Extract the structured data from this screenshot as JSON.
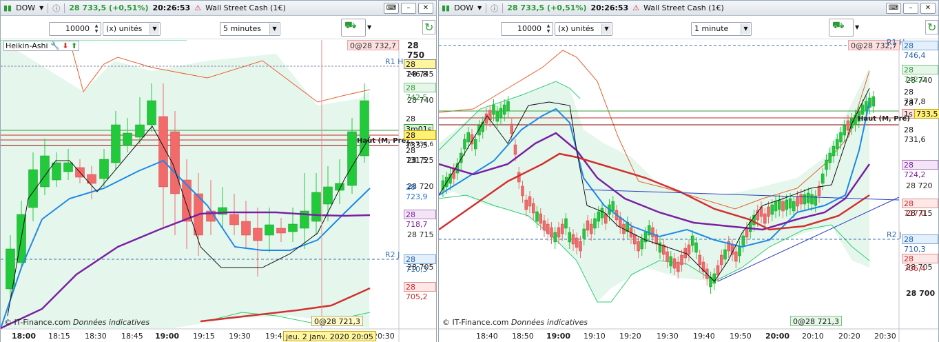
{
  "left": {
    "title": {
      "symbol": "DOW",
      "price": "28 733,5 (+0,51%)",
      "time": "20:26:53",
      "name": "Wall Street Cash (1€)"
    },
    "toolbar": {
      "qty": "10000",
      "unit": "(x) unités",
      "period": "5 minutes"
    },
    "indicator": "Heikin-Ashi",
    "order_flag": "0@28 732,7",
    "order_flag_bottom": "0@28 721,3",
    "y_ticks": [
      "28 750",
      "28 745",
      "28 740",
      "28 735",
      "28 730",
      "28 725",
      "28 720",
      "28 715",
      "28 710",
      "28 705"
    ],
    "price_tags": {
      "r1h_label": "R1 H",
      "r1h": "28 746,8",
      "bb_up": "28 742,5",
      "p735": "28 735,0",
      "countdown": "3m01s",
      "last": "28 733,5",
      "p734": "28 734,6",
      "p731": "28 731,5",
      "ma_blue": "28 723,9",
      "ma_purple": "28 718,7",
      "r2j_label": "R2 J",
      "r2j": "28 710,3",
      "ma_red": "28 705,2"
    },
    "haut_label": "Haut (M, Pré)",
    "x_labels": [
      "18:00",
      "18:15",
      "18:30",
      "18:45",
      "19:00",
      "19:15",
      "19:30",
      "19:45",
      "20:30"
    ],
    "crosshair_date": "jeu. 2 janv. 2020 20:05",
    "footer": {
      "brand": "© IT-Finance.com",
      "note": "Données indicatives"
    }
  },
  "right": {
    "title": {
      "symbol": "DOW",
      "price": "28 733,5 (+0,51%)",
      "time": "20:26:53",
      "name": "Wall Street Cash (1€)"
    },
    "toolbar": {
      "qty": "10000",
      "unit": "(x) unités",
      "period": "1 minute"
    },
    "order_flag": "0@28 732,7",
    "order_flag_bottom": "0@28 721,3",
    "y_ticks": [
      "28 740",
      "28 735",
      "28 730",
      "28 725",
      "28 720",
      "28 715",
      "28 710",
      "28 705",
      "28 700"
    ],
    "price_tags": {
      "r1_label": "R1 H",
      "r1": "28 746,4",
      "bb_up": "28 742,0",
      "p737": "28 737,8",
      "p734": "28 734,4",
      "countdown": "1s",
      "last": "733,5",
      "p731": "28 731,6",
      "ma_purple": "28 724,2",
      "ma_red": "28 717,0",
      "r2_label": "R2 J",
      "r2": "28 710,3",
      "bb_low": "28 706,4"
    },
    "haut_label": "Haut (M, Pré)",
    "x_labels": [
      "18:40",
      "18:50",
      "19:00",
      "19:10",
      "19:20",
      "19:30",
      "19:40",
      "19:50",
      "20:00",
      "20:10",
      "20:20",
      "20:30"
    ],
    "footer": {
      "brand": "© IT-Finance.com",
      "note": "Données indicatives"
    }
  },
  "colors": {
    "up": "#22c93a",
    "down": "#f26a6a",
    "blue": "#1e88e5",
    "purple": "#7b1fa2",
    "red": "#d32f2f",
    "band": "#2ecc71"
  }
}
